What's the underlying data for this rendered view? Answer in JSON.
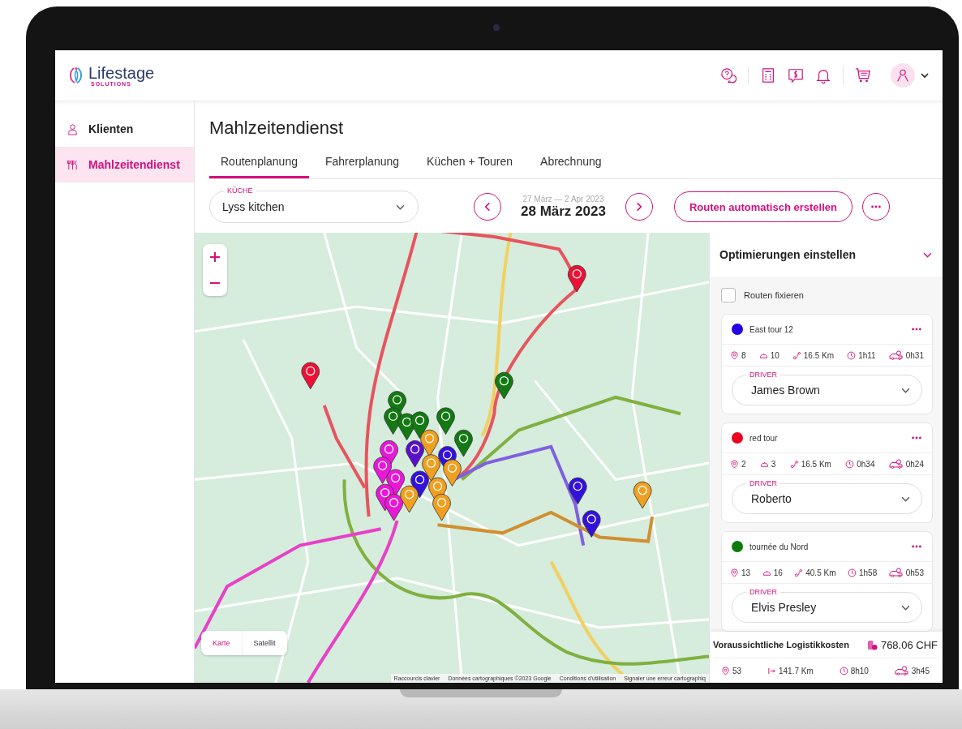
{
  "app": {
    "logo_name": "Lifestage",
    "logo_tagline": "SOLUTIONS"
  },
  "sidebar": {
    "items": [
      {
        "label": "Klienten",
        "selected": false,
        "kind": "clients"
      },
      {
        "label": "Mahlzeitendienst",
        "selected": true,
        "kind": "meals"
      }
    ]
  },
  "page": {
    "title": "Mahlzeitendienst"
  },
  "tabs": [
    {
      "label": "Routenplanung",
      "selected": true
    },
    {
      "label": "Fahrerplanung",
      "selected": false
    },
    {
      "label": "Küchen + Touren",
      "selected": false
    },
    {
      "label": "Abrechnung",
      "selected": false
    }
  ],
  "kitchen_field": {
    "label": "KÜCHE",
    "value": "Lyss kitchen"
  },
  "date_nav": {
    "range": "27 März — 2 Apr 2023",
    "date": "28 März 2023"
  },
  "auto_button": {
    "label": "Routen automatisch erstellen"
  },
  "map": {
    "map_types": [
      {
        "label": "Karte",
        "selected": true
      },
      {
        "label": "Satellit",
        "selected": false
      }
    ],
    "attribution": [
      "Raccourcis clavier",
      "Données cartographiques ©2023 Google",
      "Conditions d'utilisation",
      "Signaler une erreur cartographiq"
    ]
  },
  "panel": {
    "title": "Optimierungen einstellen",
    "fix_routes": {
      "label": "Routen fixieren",
      "checked": false
    },
    "tours": [
      {
        "name": "East tour 12",
        "color": "#2200e6",
        "stops": "8",
        "meals": "10",
        "distance": "16.5 Km",
        "duration": "1h11",
        "drive_time": "0h31",
        "driver_label": "DRIVER",
        "driver": "James Brown"
      },
      {
        "name": "red tour",
        "color": "#ee0022",
        "stops": "2",
        "meals": "3",
        "distance": "16.5 Km",
        "duration": "0h34",
        "drive_time": "0h24",
        "driver_label": "DRIVER",
        "driver": "Roberto"
      },
      {
        "name": "tournée du Nord",
        "color": "#0d7a0d",
        "stops": "13",
        "meals": "16",
        "distance": "40.5 Km",
        "duration": "1h58",
        "drive_time": "0h53",
        "driver_label": "DRIVER",
        "driver": "Elvis Presley"
      }
    ],
    "totals": {
      "label": "Voraussichtliche Logistikkosten",
      "amount": "768.06 CHF",
      "stops": "53",
      "distance": "141.7 Km",
      "duration": "8h10",
      "drive_time": "3h45"
    }
  }
}
